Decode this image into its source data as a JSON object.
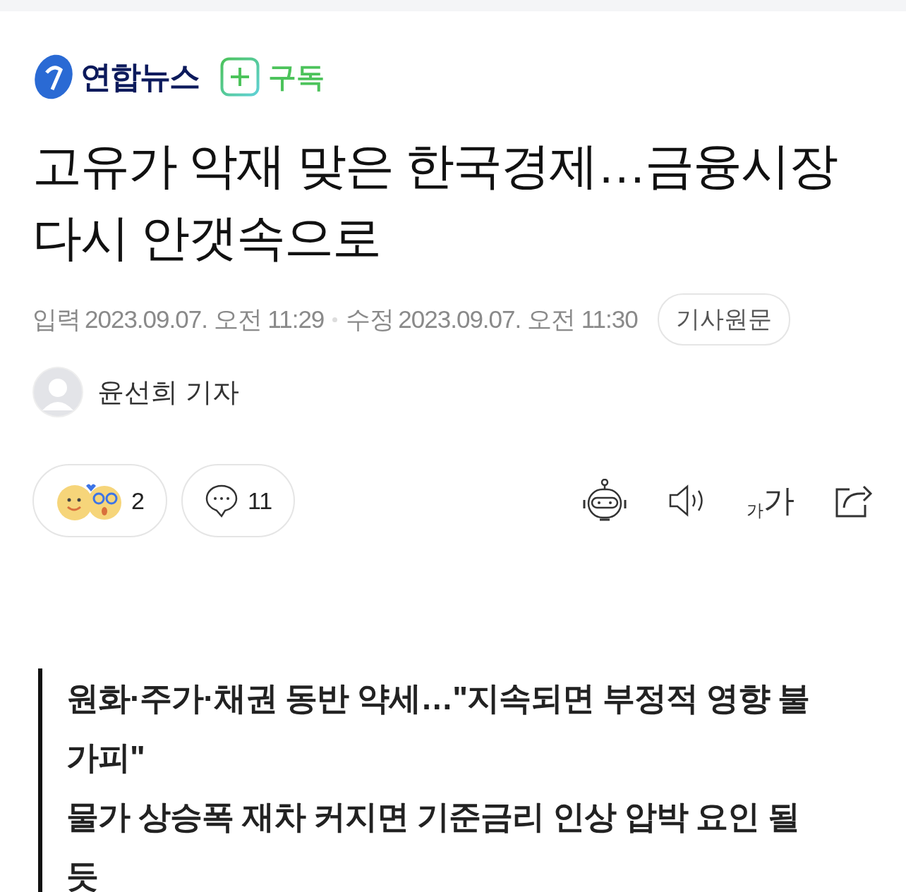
{
  "press": {
    "name": "연합뉴스",
    "subscribe": "구독"
  },
  "headline": "고유가 악재 맞은 한국경제…금융시장 다시 안갯속으로",
  "meta": {
    "input_label": "입력",
    "input_time": "2023.09.07. 오전 11:29",
    "edit_label": "수정",
    "edit_time": "2023.09.07. 오전 11:30",
    "original_button": "기사원문"
  },
  "reporter": "윤선희 기자",
  "reactions": {
    "count": "2"
  },
  "comments": {
    "count": "11"
  },
  "font_size": {
    "small": "가",
    "large": "가"
  },
  "summary": [
    "원화·주가·채권 동반 약세…\"지속되면 부정적 영향 불가피\"",
    "물가 상승폭 재차 커지면 기준금리 인상 압박 요인 될 듯"
  ]
}
